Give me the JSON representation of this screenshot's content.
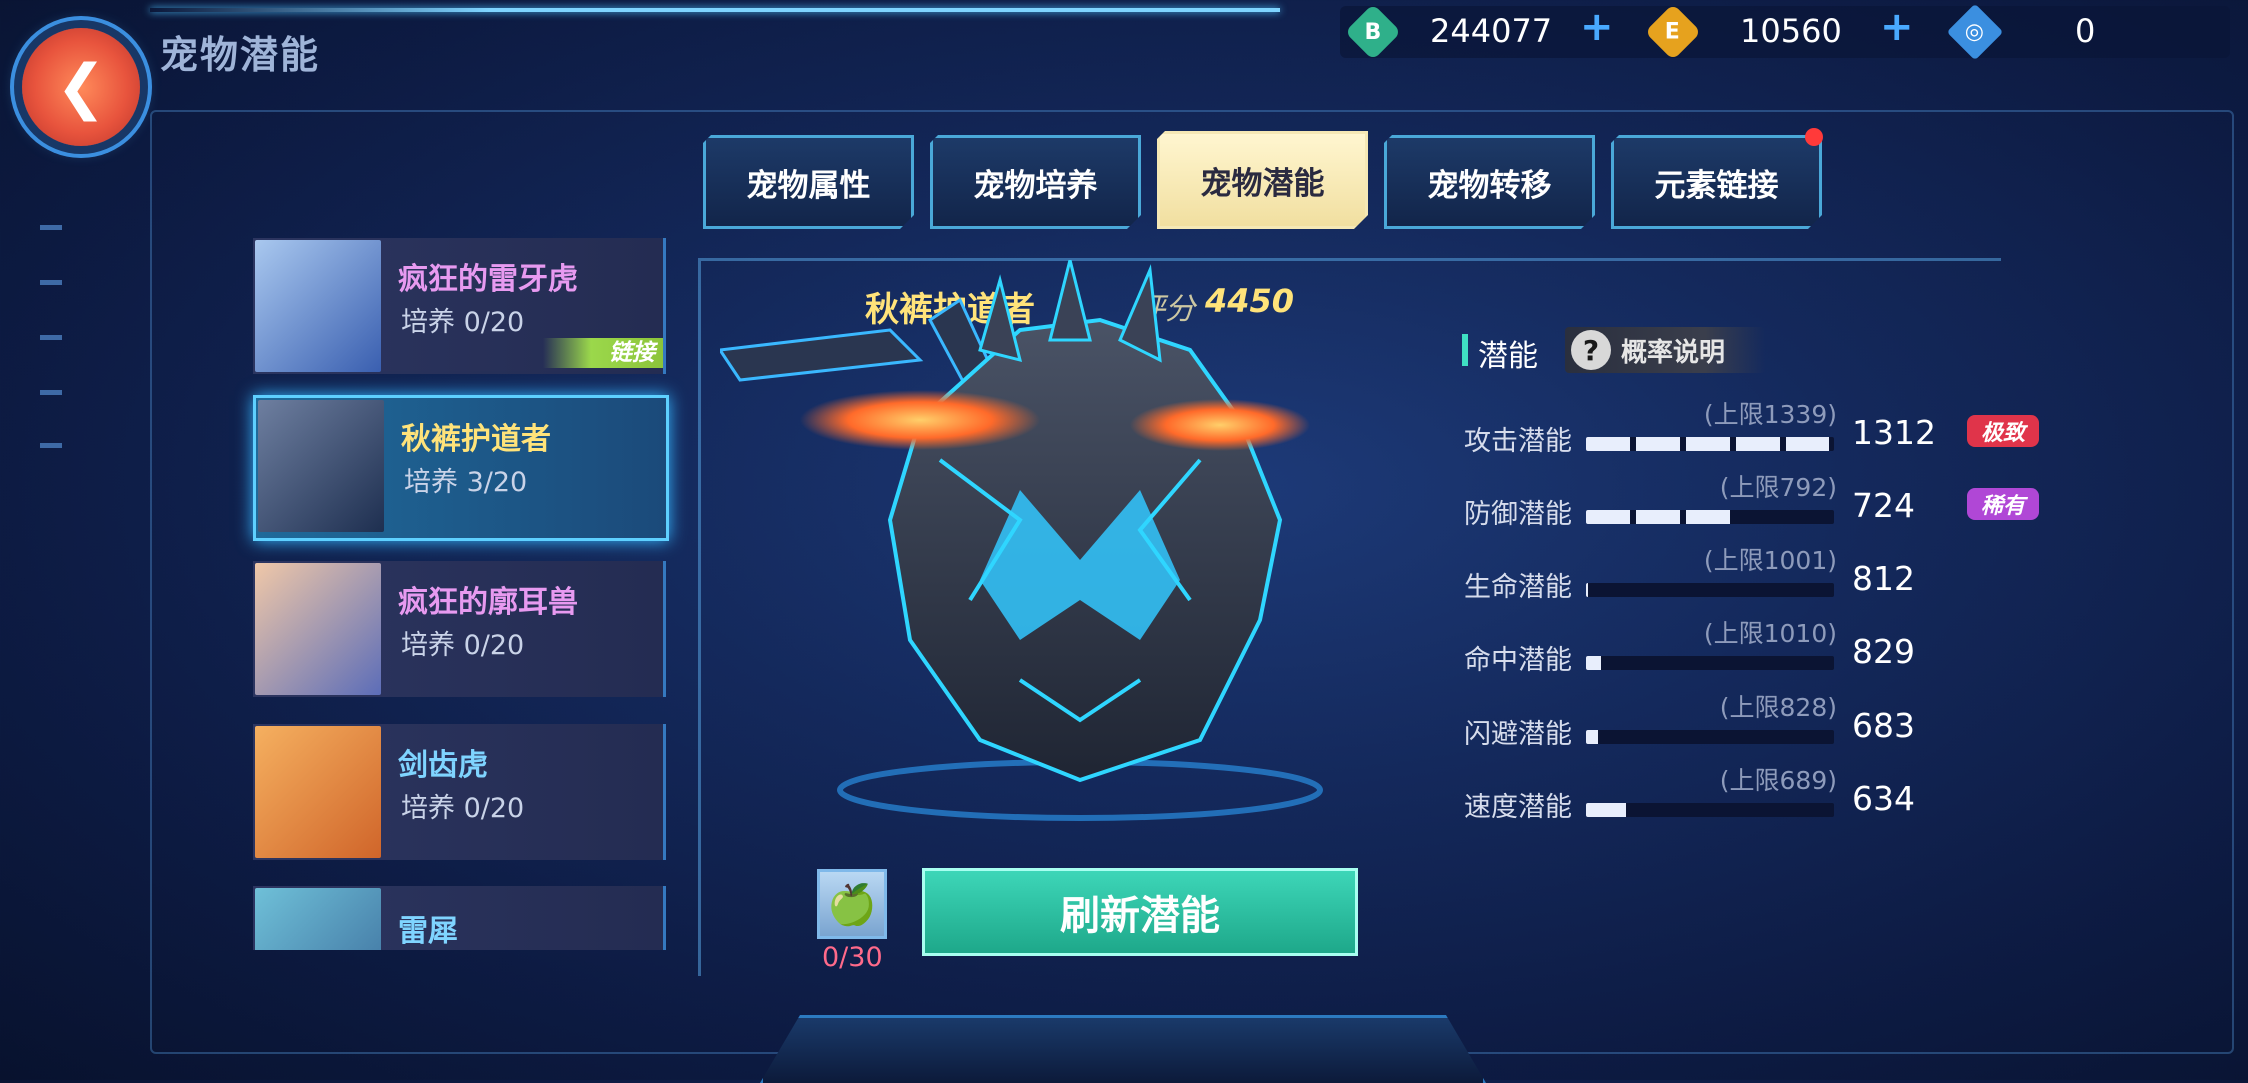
{
  "header": {
    "title": "宠物潜能",
    "back_icon": "back-arrow-icon",
    "currencies": [
      {
        "icon": "b-coin-icon",
        "letter": "B",
        "value": "244077",
        "color": "#2fb08a"
      },
      {
        "icon": "e-coin-icon",
        "letter": "E",
        "value": "10560",
        "color": "#e6a21e"
      },
      {
        "icon": "ticket-icon",
        "letter": "◎",
        "value": "0",
        "color": "#3b8fe0"
      }
    ]
  },
  "tabs": [
    {
      "label": "宠物属性",
      "active": false
    },
    {
      "label": "宠物培养",
      "active": false
    },
    {
      "label": "宠物潜能",
      "active": true
    },
    {
      "label": "宠物转移",
      "active": false
    },
    {
      "label": "元素链接",
      "active": false,
      "notify": true
    }
  ],
  "pets": [
    {
      "name": "疯狂的雷牙虎",
      "train": "培养 0/20",
      "name_color": "#e79af0",
      "link": "链接"
    },
    {
      "name": "秋裤护道者",
      "train": "培养 3/20",
      "name_color": "#ffe37a",
      "active": true
    },
    {
      "name": "疯狂的廓耳兽",
      "train": "培养 0/20",
      "name_color": "#e79af0"
    },
    {
      "name": "剑齿虎",
      "train": "培养 0/20",
      "name_color": "#7fd4ff"
    },
    {
      "name": "雷犀",
      "train": "",
      "name_color": "#7fd4ff"
    }
  ],
  "selected_pet": {
    "name": "秋裤护道者",
    "score_label": "评分",
    "score": "4450"
  },
  "potential": {
    "header": "潜能",
    "help_icon": "question-icon",
    "prob_label": "概率说明",
    "stats": [
      {
        "name": "攻击潜能",
        "cap": "(上限1339)",
        "value": "1312",
        "ratio": 0.98,
        "badge": "极致",
        "badge_color": "#e0344a"
      },
      {
        "name": "防御潜能",
        "cap": "(上限792)",
        "value": "724",
        "ratio": 0.6,
        "badge": "稀有",
        "badge_color": "#b047d6"
      },
      {
        "name": "生命潜能",
        "cap": "(上限1001)",
        "value": "812",
        "ratio": 0.01
      },
      {
        "name": "命中潜能",
        "cap": "(上限1010)",
        "value": "829",
        "ratio": 0.06
      },
      {
        "name": "闪避潜能",
        "cap": "(上限828)",
        "value": "683",
        "ratio": 0.05
      },
      {
        "name": "速度潜能",
        "cap": "(上限689)",
        "value": "634",
        "ratio": 0.16
      }
    ]
  },
  "actions": {
    "fruit_icon": "apple-icon",
    "fruit_count": "0/30",
    "refresh_label": "刷新潜能"
  }
}
